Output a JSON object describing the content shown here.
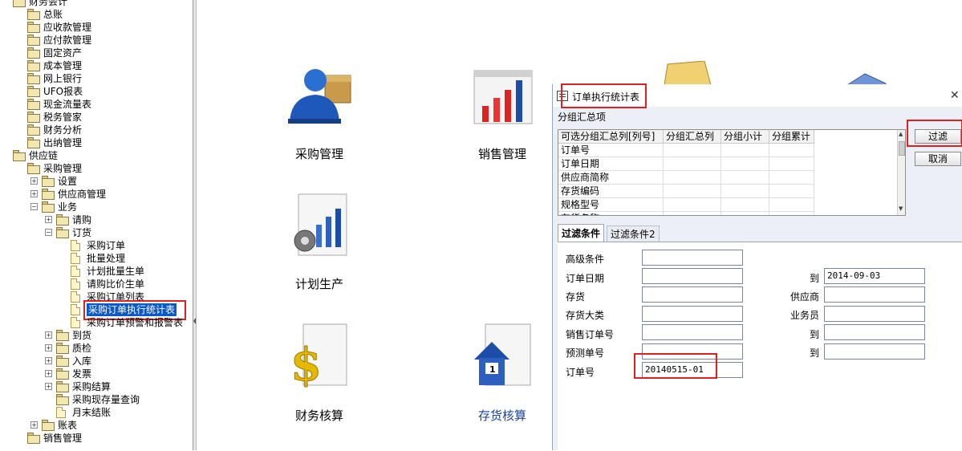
{
  "tree": {
    "items": [
      {
        "label": "财务会计",
        "depth": 0,
        "type": "folder",
        "expanded": true
      },
      {
        "label": "总账",
        "depth": 1,
        "type": "folder"
      },
      {
        "label": "应收款管理",
        "depth": 1,
        "type": "folder"
      },
      {
        "label": "应付款管理",
        "depth": 1,
        "type": "folder"
      },
      {
        "label": "固定资产",
        "depth": 1,
        "type": "folder"
      },
      {
        "label": "成本管理",
        "depth": 1,
        "type": "folder"
      },
      {
        "label": "网上银行",
        "depth": 1,
        "type": "folder"
      },
      {
        "label": "UFO报表",
        "depth": 1,
        "type": "folder"
      },
      {
        "label": "现金流量表",
        "depth": 1,
        "type": "folder"
      },
      {
        "label": "税务管家",
        "depth": 1,
        "type": "folder"
      },
      {
        "label": "财务分析",
        "depth": 1,
        "type": "folder"
      },
      {
        "label": "出纳管理",
        "depth": 1,
        "type": "folder"
      },
      {
        "label": "供应链",
        "depth": 0,
        "type": "folder",
        "expanded": true
      },
      {
        "label": "采购管理",
        "depth": 1,
        "type": "folder",
        "expanded": true
      },
      {
        "label": "设置",
        "depth": 2,
        "type": "folder",
        "collapsed": true
      },
      {
        "label": "供应商管理",
        "depth": 2,
        "type": "folder",
        "collapsed": true
      },
      {
        "label": "业务",
        "depth": 2,
        "type": "folder",
        "expanded": true
      },
      {
        "label": "请购",
        "depth": 3,
        "type": "folder",
        "collapsed": true
      },
      {
        "label": "订货",
        "depth": 3,
        "type": "folder",
        "expanded": true
      },
      {
        "label": "采购订单",
        "depth": 4,
        "type": "page"
      },
      {
        "label": "批量处理",
        "depth": 4,
        "type": "page"
      },
      {
        "label": "计划批量生单",
        "depth": 4,
        "type": "page"
      },
      {
        "label": "请购比价生单",
        "depth": 4,
        "type": "page"
      },
      {
        "label": "采购订单列表",
        "depth": 4,
        "type": "page"
      },
      {
        "label": "采购订单执行统计表",
        "depth": 4,
        "type": "page",
        "selected": true
      },
      {
        "label": "采购订单预警和报警表",
        "depth": 4,
        "type": "page"
      },
      {
        "label": "到货",
        "depth": 3,
        "type": "folder",
        "collapsed": true
      },
      {
        "label": "质检",
        "depth": 3,
        "type": "folder",
        "collapsed": true
      },
      {
        "label": "入库",
        "depth": 3,
        "type": "folder",
        "collapsed": true
      },
      {
        "label": "发票",
        "depth": 3,
        "type": "folder",
        "collapsed": true
      },
      {
        "label": "采购结算",
        "depth": 3,
        "type": "folder",
        "collapsed": true
      },
      {
        "label": "采购现存量查询",
        "depth": 3,
        "type": "folder"
      },
      {
        "label": "月末结账",
        "depth": 3,
        "type": "page"
      },
      {
        "label": "账表",
        "depth": 2,
        "type": "folder",
        "collapsed": true
      },
      {
        "label": "销售管理",
        "depth": 1,
        "type": "folder"
      }
    ]
  },
  "modules": [
    {
      "label": "采购管理",
      "icon": "purchase-icon"
    },
    {
      "label": "销售管理",
      "icon": "sales-chart-icon"
    },
    {
      "label": "计划生产",
      "icon": "production-plan-icon"
    },
    {
      "label": "财务核算",
      "icon": "finance-dollar-icon"
    },
    {
      "label": "存货核算",
      "icon": "inventory-house-icon",
      "color": "#1a3fa8"
    }
  ],
  "dialog": {
    "title": "订单执行统计表",
    "group_title": "分组汇总项",
    "grid_headers": [
      "可选分组汇总列[列号]",
      "分组汇总列",
      "分组小计",
      "分组累计"
    ],
    "grid_rows": [
      "订单号",
      "订单日期",
      "供应商简称",
      "存货编码",
      "规格型号",
      "存货名称"
    ],
    "buttons": {
      "filter": "过滤",
      "cancel": "取消"
    },
    "tabs": [
      "过滤条件",
      "过滤条件2"
    ],
    "fields": {
      "advanced": {
        "label": "高级条件",
        "value": ""
      },
      "order_date": {
        "label": "订单日期",
        "from": "",
        "to_label": "到",
        "to": "2014-09-03"
      },
      "inventory": {
        "label": "存货",
        "value": ""
      },
      "supplier": {
        "label": "供应商",
        "value": ""
      },
      "inventory_class": {
        "label": "存货大类",
        "value": ""
      },
      "salesperson": {
        "label": "业务员",
        "value": ""
      },
      "sales_order_no": {
        "label": "销售订单号",
        "from": "",
        "to_label": "到",
        "to": ""
      },
      "forecast_no": {
        "label": "预测单号",
        "from": "",
        "to_label": "到",
        "to": ""
      },
      "order_no": {
        "label": "订单号",
        "value": "20140515-01"
      }
    }
  },
  "colors": {
    "highlight": "#e02020",
    "selection": "#0a58c9"
  }
}
